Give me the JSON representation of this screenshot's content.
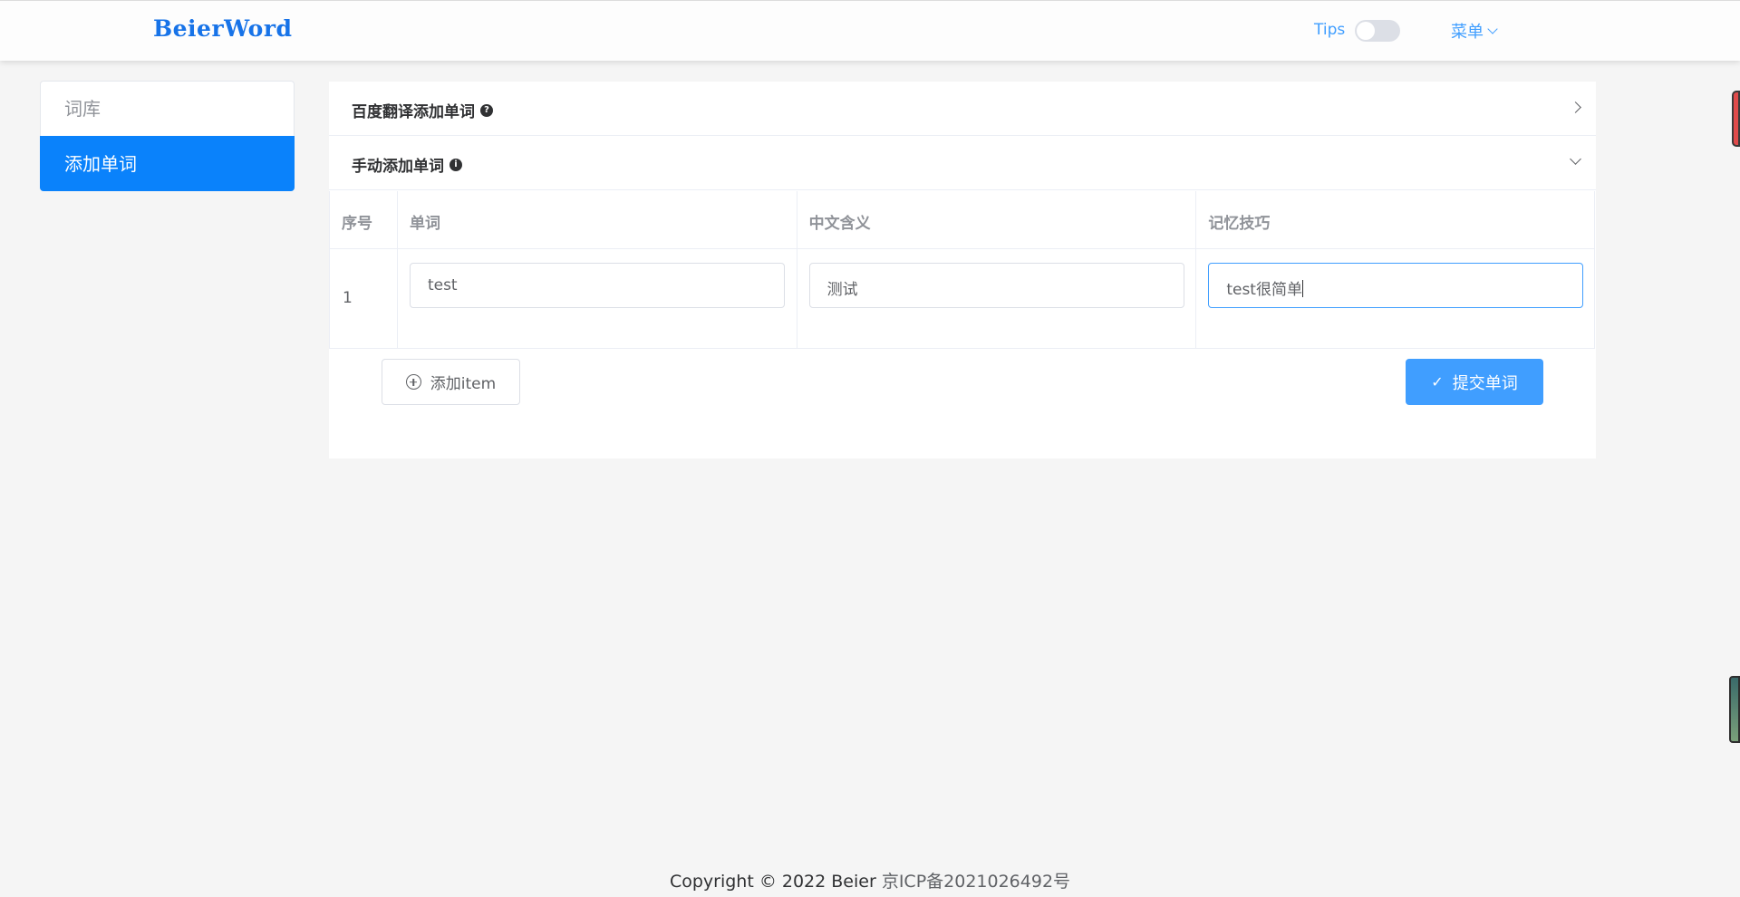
{
  "header": {
    "logo": "BeierWord",
    "tips_label": "Tips",
    "tips_enabled": false,
    "menu_label": "菜单"
  },
  "sidebar": {
    "items": [
      {
        "label": "词库",
        "active": false
      },
      {
        "label": "添加单词",
        "active": true
      }
    ]
  },
  "panel": {
    "sections": [
      {
        "title": "百度翻译添加单词",
        "icon": "question-circle-icon",
        "expanded": false
      },
      {
        "title": "手动添加单词",
        "icon": "info-circle-icon",
        "expanded": true
      }
    ],
    "table": {
      "columns": [
        "序号",
        "单词",
        "中文含义",
        "记忆技巧"
      ],
      "rows": [
        {
          "index": "1",
          "word": "test",
          "meaning": "测试",
          "tip": "test很简单"
        }
      ]
    },
    "add_item_label": "添加item",
    "submit_label": "提交单词"
  },
  "footer": {
    "copyright": "Copyright © 2022 Beier",
    "beian": "京ICP备2021026492号"
  },
  "colors": {
    "accent": "#409eff",
    "sidebar_active": "#0a82fb",
    "logo": "#1773e8"
  }
}
